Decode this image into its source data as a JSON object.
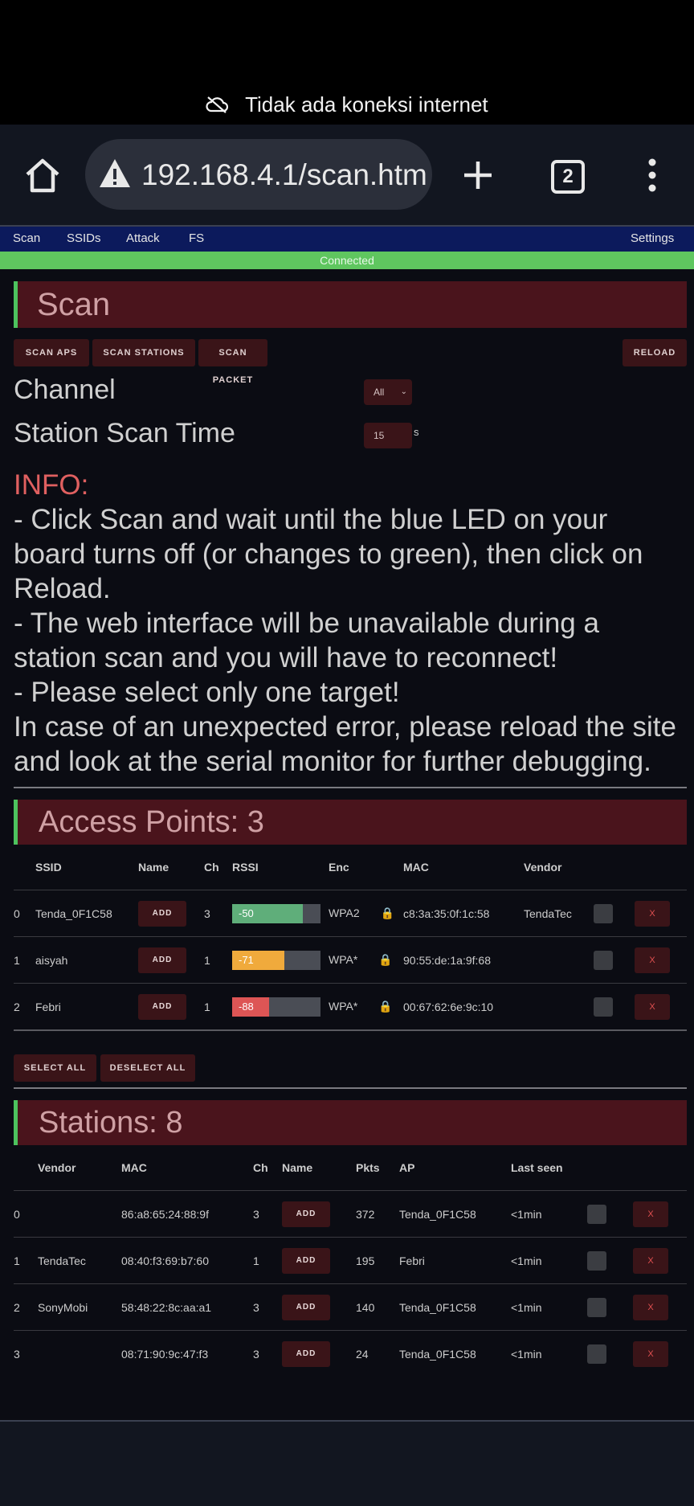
{
  "system": {
    "offline_text": "Tidak ada koneksi internet"
  },
  "browser": {
    "url": "192.168.4.1/scan.htm",
    "tab_count": "2"
  },
  "nav": {
    "scan": "Scan",
    "ssids": "SSIDs",
    "attack": "Attack",
    "fs": "FS",
    "settings": "Settings"
  },
  "status": "Connected",
  "scan_section": {
    "title": "Scan",
    "buttons": {
      "scan_aps": "SCAN APS",
      "scan_stations": "SCAN STATIONS",
      "scan_packet": "SCAN PACKET",
      "reload": "RELOAD"
    },
    "channel_label": "Channel",
    "channel_value": "All",
    "station_scan_time_label": "Station Scan Time",
    "station_scan_time_value": "15",
    "station_scan_time_unit": "s"
  },
  "info": {
    "title": "INFO:",
    "line1": "- Click Scan and wait until the blue LED on your board turns off (or changes to green), then click on Reload.",
    "line2": "- The web interface will be unavailable during a station scan and you will have to reconnect!",
    "line3": "- Please select only one target!",
    "line4": "In case of an unexpected error, please reload the site and look at the serial monitor for further debugging."
  },
  "access_points": {
    "title": "Access Points: 3",
    "headers": {
      "ssid": "SSID",
      "name": "Name",
      "ch": "Ch",
      "rssi": "RSSI",
      "enc": "Enc",
      "mac": "MAC",
      "vendor": "Vendor"
    },
    "add_label": "ADD",
    "remove_label": "X",
    "rows": [
      {
        "id": "0",
        "ssid": "Tenda_0F1C58",
        "ch": "3",
        "rssi": "-50",
        "rssi_level": 0.8,
        "rssi_color": "#5fae7a",
        "enc": "WPA2",
        "mac": "c8:3a:35:0f:1c:58",
        "vendor": "TendaTec"
      },
      {
        "id": "1",
        "ssid": "aisyah",
        "ch": "1",
        "rssi": "-71",
        "rssi_level": 0.59,
        "rssi_color": "#f0aa3c",
        "enc": "WPA*",
        "mac": "90:55:de:1a:9f:68",
        "vendor": ""
      },
      {
        "id": "2",
        "ssid": "Febri",
        "ch": "1",
        "rssi": "-88",
        "rssi_level": 0.42,
        "rssi_color": "#dd5555",
        "enc": "WPA*",
        "mac": "00:67:62:6e:9c:10",
        "vendor": ""
      }
    ],
    "select_all": "SELECT ALL",
    "deselect_all": "DESELECT ALL"
  },
  "stations": {
    "title": "Stations: 8",
    "headers": {
      "vendor": "Vendor",
      "mac": "MAC",
      "ch": "Ch",
      "name": "Name",
      "pkts": "Pkts",
      "ap": "AP",
      "last_seen": "Last seen"
    },
    "add_label": "ADD",
    "remove_label": "X",
    "rows": [
      {
        "id": "0",
        "vendor": "",
        "mac": "86:a8:65:24:88:9f",
        "ch": "3",
        "pkts": "372",
        "ap": "Tenda_0F1C58",
        "last_seen": "<1min"
      },
      {
        "id": "1",
        "vendor": "TendaTec",
        "mac": "08:40:f3:69:b7:60",
        "ch": "1",
        "pkts": "195",
        "ap": "Febri",
        "last_seen": "<1min"
      },
      {
        "id": "2",
        "vendor": "SonyMobi",
        "mac": "58:48:22:8c:aa:a1",
        "ch": "3",
        "pkts": "140",
        "ap": "Tenda_0F1C58",
        "last_seen": "<1min"
      },
      {
        "id": "3",
        "vendor": "",
        "mac": "08:71:90:9c:47:f3",
        "ch": "3",
        "pkts": "24",
        "ap": "Tenda_0F1C58",
        "last_seen": "<1min"
      }
    ]
  }
}
